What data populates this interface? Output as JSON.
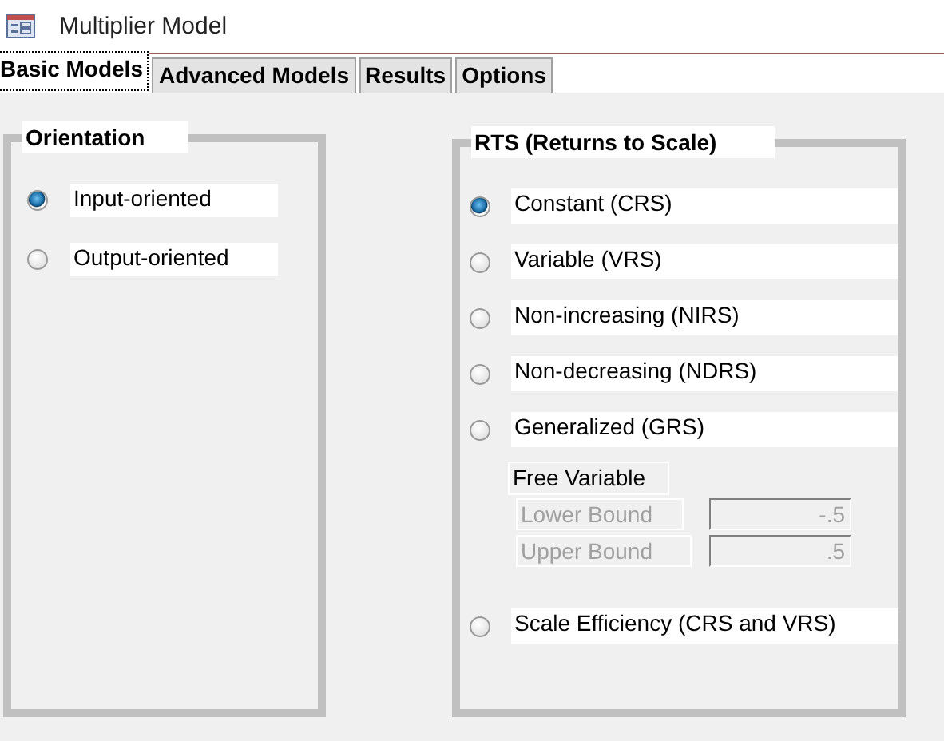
{
  "window": {
    "title": "Multiplier Model"
  },
  "tabs": [
    {
      "label": "Basic Models",
      "selected": true
    },
    {
      "label": "Advanced Models",
      "selected": false
    },
    {
      "label": "Results",
      "selected": false
    },
    {
      "label": "Options",
      "selected": false
    }
  ],
  "orientation": {
    "title": "Orientation",
    "options": [
      {
        "label": "Input-oriented",
        "selected": true
      },
      {
        "label": "Output-oriented",
        "selected": false
      }
    ]
  },
  "rts": {
    "title": "RTS (Returns to Scale)",
    "items": [
      {
        "kind": "radio",
        "label": "Constant (CRS)",
        "selected": true
      },
      {
        "kind": "radio",
        "label": "Variable (VRS)",
        "selected": false
      },
      {
        "kind": "radio",
        "label": "Non-increasing (NIRS)",
        "selected": false
      },
      {
        "kind": "radio",
        "label": "Non-decreasing (NDRS)",
        "selected": false
      },
      {
        "kind": "radio",
        "label": "Generalized (GRS)",
        "selected": false
      },
      {
        "kind": "bounds",
        "title": "Free Variable",
        "disabled": true,
        "fields": [
          {
            "label": "Lower Bound",
            "value": "-.5"
          },
          {
            "label": "Upper Bound",
            "value": ".5"
          }
        ]
      },
      {
        "kind": "radio",
        "label": "Scale Efficiency (CRS and VRS)",
        "selected": false
      }
    ]
  }
}
